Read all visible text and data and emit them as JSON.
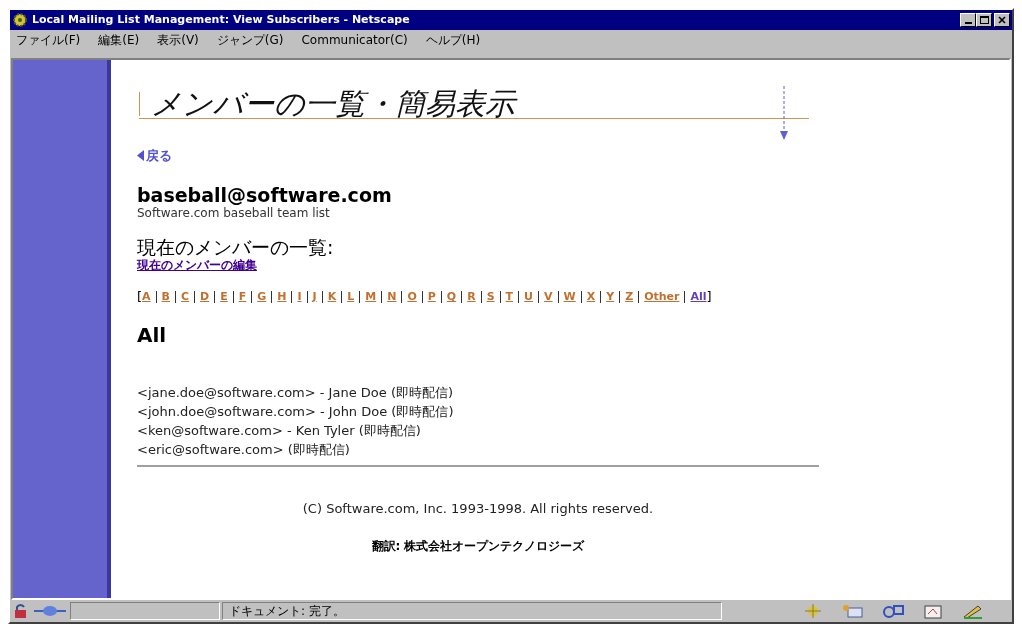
{
  "window": {
    "title": "Local Mailing List Management: View Subscribers - Netscape"
  },
  "menu": [
    "ファイル(F)",
    "編集(E)",
    "表示(V)",
    "ジャンプ(G)",
    "Communicator(C)",
    "ヘルプ(H)"
  ],
  "page": {
    "title": "メンバーの一覧・簡易表示",
    "back_link": "戻る",
    "list_address": "baseball@software.com",
    "list_description": "Software.com baseball team list",
    "section_heading": "現在のメンバーの一覧:",
    "edit_link": "現在のメンバーの編集",
    "letters": [
      {
        "label": "A",
        "visited": false
      },
      {
        "label": "B",
        "visited": false
      },
      {
        "label": "C",
        "visited": false
      },
      {
        "label": "D",
        "visited": false
      },
      {
        "label": "E",
        "visited": false
      },
      {
        "label": "F",
        "visited": false
      },
      {
        "label": "G",
        "visited": false
      },
      {
        "label": "H",
        "visited": false
      },
      {
        "label": "I",
        "visited": false
      },
      {
        "label": "J",
        "visited": false
      },
      {
        "label": "K",
        "visited": false
      },
      {
        "label": "L",
        "visited": false
      },
      {
        "label": "M",
        "visited": false
      },
      {
        "label": "N",
        "visited": false
      },
      {
        "label": "O",
        "visited": false
      },
      {
        "label": "P",
        "visited": false
      },
      {
        "label": "Q",
        "visited": false
      },
      {
        "label": "R",
        "visited": false
      },
      {
        "label": "S",
        "visited": false
      },
      {
        "label": "T",
        "visited": false
      },
      {
        "label": "U",
        "visited": false
      },
      {
        "label": "V",
        "visited": false
      },
      {
        "label": "W",
        "visited": false
      },
      {
        "label": "X",
        "visited": false
      },
      {
        "label": "Y",
        "visited": false
      },
      {
        "label": "Z",
        "visited": false
      },
      {
        "label": "Other",
        "visited": false
      },
      {
        "label": "All",
        "visited": true
      }
    ],
    "letter_brackets": [
      "[",
      "]"
    ],
    "filter_heading": "All",
    "subscribers": [
      "<jane.doe@software.com> - Jane Doe (即時配信)",
      "<john.doe@software.com> - John Doe (即時配信)",
      "<ken@software.com> - Ken Tyler (即時配信)",
      "<eric@software.com> (即時配信)"
    ],
    "copyright": "(C) Software.com, Inc. 1993-1998. All rights reserved.",
    "translation_credit": "翻訳: 株式会社オープンテクノロジーズ"
  },
  "status_bar": {
    "text": "ドキュメント: 完了。"
  }
}
